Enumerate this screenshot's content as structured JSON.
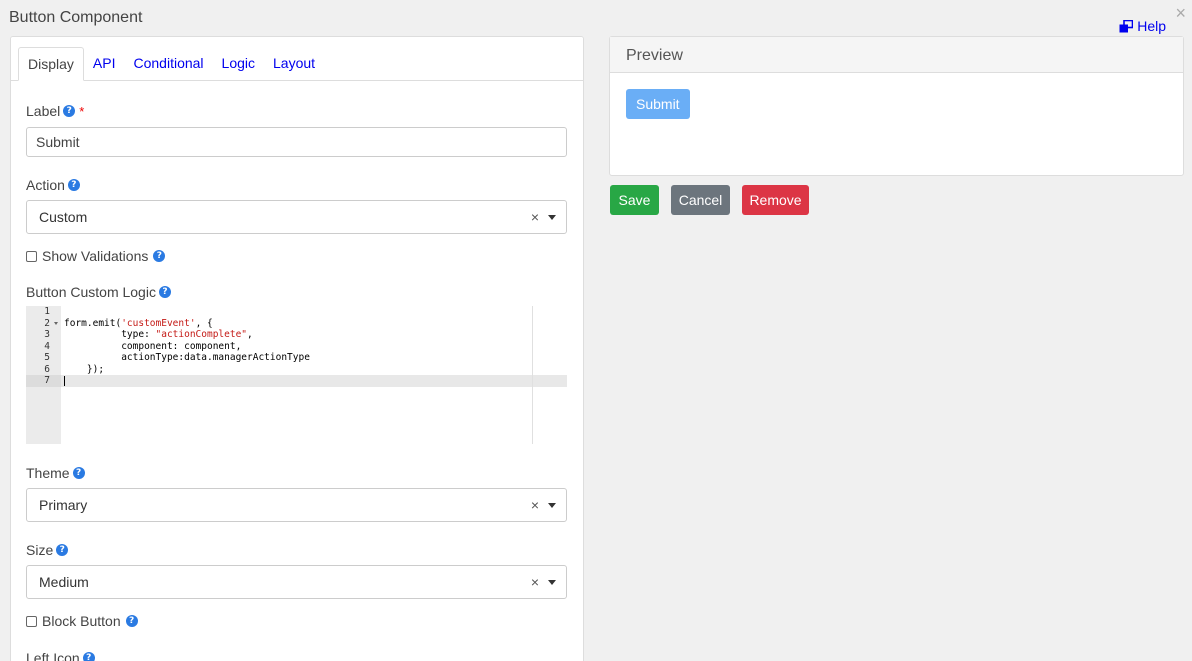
{
  "dialog": {
    "title": "Button Component",
    "close_glyph": "×",
    "help_label": "Help"
  },
  "tabs": [
    {
      "label": "Display",
      "active": true
    },
    {
      "label": "API",
      "active": false
    },
    {
      "label": "Conditional",
      "active": false
    },
    {
      "label": "Logic",
      "active": false
    },
    {
      "label": "Layout",
      "active": false
    }
  ],
  "fields": {
    "label": {
      "label": "Label",
      "required_mark": "*",
      "value": "Submit"
    },
    "action": {
      "label": "Action",
      "value": "Custom"
    },
    "show_validations": {
      "label": "Show Validations",
      "checked": false
    },
    "custom_logic": {
      "label": "Button Custom Logic",
      "line_numbers": [
        "1",
        "2",
        "3",
        "4",
        "5",
        "6",
        "7"
      ],
      "code_lines": [
        "",
        "form.emit('customEvent', {",
        "          type: \"actionComplete\",",
        "          component: component,",
        "          actionType:data.managerActionType",
        "    });",
        ""
      ]
    },
    "theme": {
      "label": "Theme",
      "value": "Primary"
    },
    "size": {
      "label": "Size",
      "value": "Medium"
    },
    "block_button": {
      "label": "Block Button",
      "checked": false
    },
    "left_icon": {
      "label": "Left Icon"
    }
  },
  "select_clear_glyph": "×",
  "help_glyph": "?",
  "preview": {
    "title": "Preview",
    "button_label": "Submit"
  },
  "actions": {
    "save": "Save",
    "cancel": "Cancel",
    "remove": "Remove"
  },
  "colors": {
    "save": "#28a745",
    "cancel": "#6c757d",
    "remove": "#dc3545",
    "primary_preview": "#6aaef6",
    "link": "#0000ee",
    "help_icon": "#2a7ae2"
  },
  "icons": {
    "help": "external-window-icon",
    "close": "close-icon",
    "tooltip": "question-circle-icon",
    "select_clear": "clear-icon",
    "select_toggle": "caret-down-icon",
    "code_fold": "fold-arrow-icon"
  }
}
